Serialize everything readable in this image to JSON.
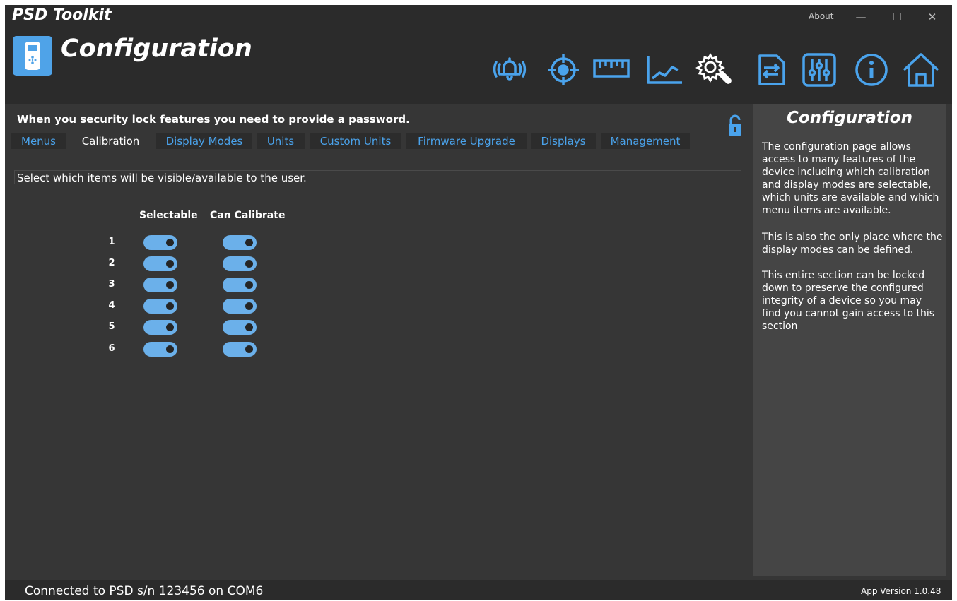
{
  "window": {
    "title": "PSD Toolkit",
    "about": "About",
    "minimize": "—",
    "maximize": "☐",
    "close": "✕"
  },
  "header": {
    "page_title": "Configuration",
    "nav_icons": [
      "alarm-icon",
      "target-icon",
      "ruler-icon",
      "chart-icon",
      "settings-wrench-icon",
      "transfer-icon",
      "sliders-icon",
      "info-icon",
      "home-icon"
    ],
    "accent_color": "#4aa3ec"
  },
  "main": {
    "lock_notice": "When you security lock features you need to provide a password.",
    "tabs": [
      {
        "label": "Menus",
        "active": false
      },
      {
        "label": "Calibration",
        "active": true
      },
      {
        "label": "Display Modes",
        "active": false
      },
      {
        "label": "Units",
        "active": false
      },
      {
        "label": "Custom Units",
        "active": false
      },
      {
        "label": "Firmware Upgrade",
        "active": false
      },
      {
        "label": "Displays",
        "active": false
      },
      {
        "label": "Management",
        "active": false
      }
    ],
    "instruction": "Select which items will be visible/available to the user.",
    "columns": {
      "selectable": "Selectable",
      "can_calibrate": "Can Calibrate"
    },
    "rows": [
      {
        "num": "1",
        "selectable": true,
        "can_calibrate": true
      },
      {
        "num": "2",
        "selectable": true,
        "can_calibrate": true
      },
      {
        "num": "3",
        "selectable": true,
        "can_calibrate": true
      },
      {
        "num": "4",
        "selectable": true,
        "can_calibrate": true
      },
      {
        "num": "5",
        "selectable": true,
        "can_calibrate": true
      },
      {
        "num": "6",
        "selectable": true,
        "can_calibrate": true
      }
    ]
  },
  "side_panel": {
    "title": "Configuration",
    "paragraphs": [
      "The configuration page allows access to many features of the device including which calibration and display modes are selectable, which units are available and which menu items are available.",
      "This is also the only place where the display modes can be defined.",
      "This entire section can be locked down to preserve the configured integrity of a device so you may find you cannot gain access to this section"
    ]
  },
  "status": {
    "connection": "Connected to PSD s/n 123456 on COM6",
    "version": "App Version 1.0.48"
  }
}
